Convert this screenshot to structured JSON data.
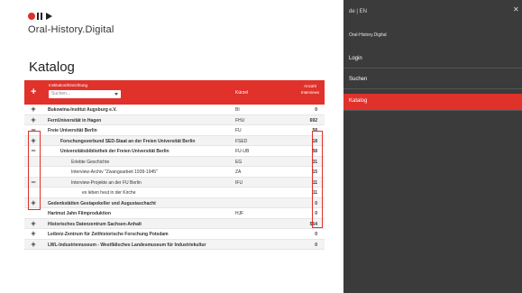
{
  "app": {
    "brand": "Oral-History.Digital"
  },
  "page": {
    "title": "Katalog"
  },
  "table": {
    "header": {
      "plus": "+",
      "institution_label": "Institution/Einrichtung",
      "select_placeholder": "Suchen...",
      "short_label": "Kürzel",
      "count_label": "Anzahl Interviews"
    },
    "rows": [
      {
        "sign": "+",
        "name": "Bukowina-Institut Augsburg e.V.",
        "short": "BI",
        "count": "0",
        "bold": true
      },
      {
        "sign": "+",
        "name": "FernUniversität in Hagen",
        "short": "FHU",
        "count": "692",
        "bold": true
      },
      {
        "sign": "−",
        "name": "Freie Universität Berlin",
        "short": "FU",
        "count": "58",
        "bold": true
      },
      {
        "sign": "+",
        "name": "Forschungsverbund SED-Staat an der Freien Universität Berlin",
        "short": "FSED",
        "count": "18",
        "bold": true
      },
      {
        "sign": "−",
        "name": "Universitätsbibliothek der Freien Universität Berlin",
        "short": "FU-UB",
        "count": "58",
        "bold": true
      },
      {
        "sign": "",
        "name": "Erlebte Geschichte",
        "short": "EG",
        "count": "31",
        "bold": false
      },
      {
        "sign": "",
        "name": "Interview-Archiv \"Zwangsarbeit 1939-1945\"",
        "short": "ZA",
        "count": "15",
        "bold": false
      },
      {
        "sign": "−",
        "name": "Interview-Projekte an der FU Berlin",
        "short": "IFU",
        "count": "11",
        "bold": false
      },
      {
        "sign": "",
        "name": "es leben heut in der Kirche",
        "short": "",
        "count": "11",
        "bold": false
      },
      {
        "sign": "+",
        "name": "Gedenkstätten Gestapokeller und Augustaschacht",
        "short": "",
        "count": "0",
        "bold": true
      },
      {
        "sign": "",
        "name": "Hartmut Jahn Filmproduktion",
        "short": "HJF",
        "count": "0",
        "bold": true
      },
      {
        "sign": "+",
        "name": "Historisches Datenzentrum Sachsen-Anhalt",
        "short": "",
        "count": "564",
        "bold": true
      },
      {
        "sign": "+",
        "name": "Leibniz-Zentrum für Zeithistorische Forschung Potsdam",
        "short": "",
        "count": "0",
        "bold": true
      },
      {
        "sign": "+",
        "name": "LWL-Industriemuseum - Westfälisches Landesmuseum für Industriekultur",
        "short": "",
        "count": "0",
        "bold": true
      }
    ]
  },
  "sidebar": {
    "search_label": "de | EN",
    "close_icon": "close-icon",
    "brand": "Oral-History.Digital",
    "items": [
      {
        "label": "Login",
        "active": false
      },
      {
        "label": "Suchen",
        "active": false
      },
      {
        "label": "Katalog",
        "active": true
      }
    ]
  },
  "colors": {
    "accent": "#e0312b",
    "sidebar_bg": "#3b3b3b"
  }
}
